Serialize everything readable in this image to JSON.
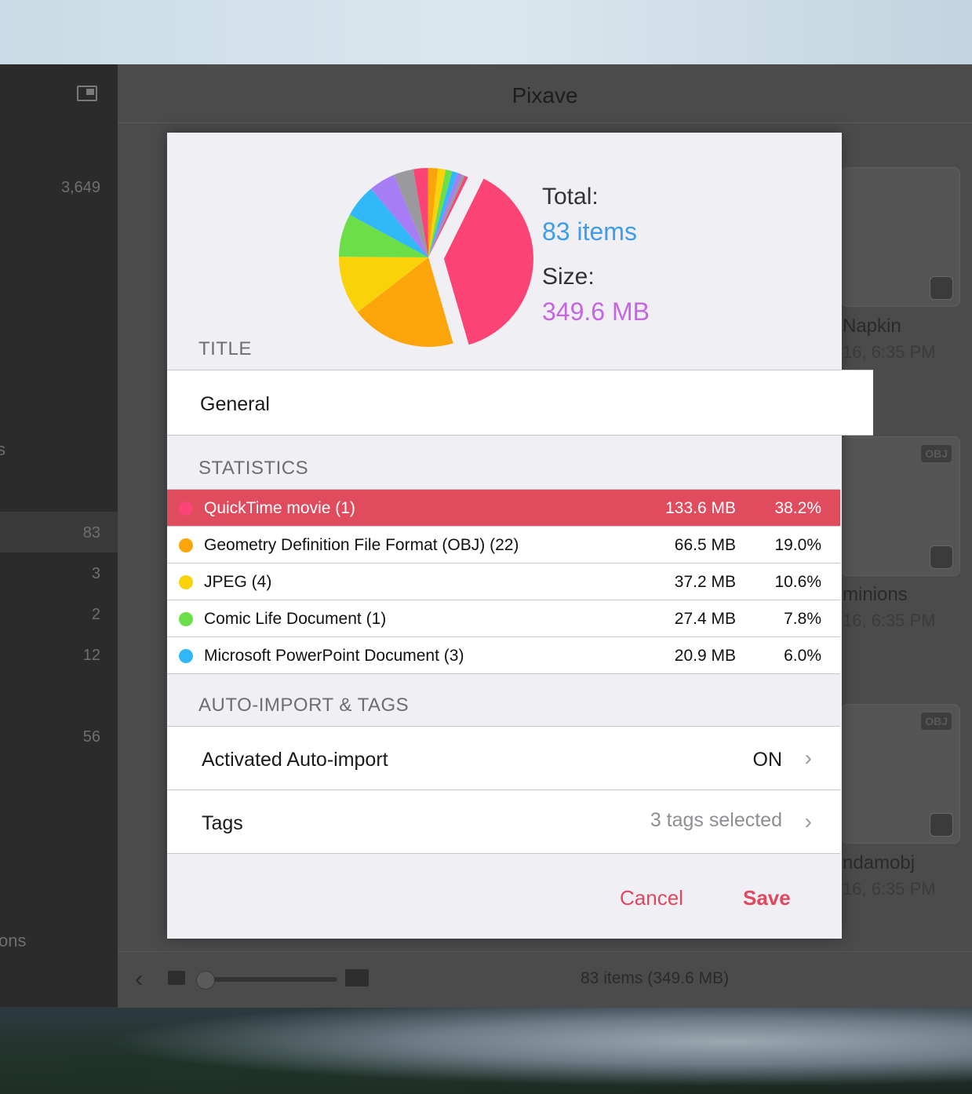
{
  "window": {
    "title": "Pixave"
  },
  "sidebar": {
    "counts": [
      "3,649",
      "83",
      "3",
      "2",
      "12",
      "56"
    ],
    "fragments": [
      "s",
      "ons"
    ]
  },
  "cards": [
    {
      "name": "Napkin",
      "date": "16, 6:35 PM",
      "badge": ""
    },
    {
      "name": "minions",
      "date": "16, 6:35 PM",
      "badge": "OBJ"
    },
    {
      "name": "ndamobj",
      "date": "16, 6:35 PM",
      "badge": "OBJ"
    }
  ],
  "bottom_bar": {
    "status": "83 items (349.6 MB)",
    "back_icon": "chevron-left-icon"
  },
  "dialog": {
    "total_label": "Total:",
    "total_value": "83 items",
    "size_label": "Size:",
    "size_value": "349.6 MB",
    "total_color": "#3d9de8",
    "size_color": "#c466e0",
    "title_header": "TITLE",
    "title_value": "General",
    "stats_header": "STATISTICS",
    "stats": [
      {
        "name": "QuickTime movie (1)",
        "size": "133.6 MB",
        "pct": "38.2%",
        "color": "#fb4475",
        "selected": true
      },
      {
        "name": "Geometry Definition File Format (OBJ) (22)",
        "size": "66.5 MB",
        "pct": "19.0%",
        "color": "#fba50a",
        "selected": false
      },
      {
        "name": "JPEG (4)",
        "size": "37.2 MB",
        "pct": "10.6%",
        "color": "#fad20a",
        "selected": false
      },
      {
        "name": "Comic Life Document (1)",
        "size": "27.4 MB",
        "pct": "7.8%",
        "color": "#6cdf48",
        "selected": false
      },
      {
        "name": "Microsoft PowerPoint Document (3)",
        "size": "20.9 MB",
        "pct": "6.0%",
        "color": "#31b8f8",
        "selected": false
      }
    ],
    "auto_header": "AUTO-IMPORT & TAGS",
    "auto_import_label": "Activated Auto-import",
    "auto_import_value": "ON",
    "tags_label": "Tags",
    "tags_value": "3 tags selected",
    "cancel_label": "Cancel",
    "save_label": "Save"
  },
  "chart_data": {
    "type": "pie",
    "exploded_first_slice": true,
    "slices": [
      {
        "label": "QuickTime movie (1)",
        "value": 38.2,
        "color": "#fb4475"
      },
      {
        "label": "Geometry Definition File Format (OBJ) (22)",
        "value": 19.0,
        "color": "#fba50a"
      },
      {
        "label": "JPEG (4)",
        "value": 10.6,
        "color": "#fad20a"
      },
      {
        "label": "Comic Life Document (1)",
        "value": 7.8,
        "color": "#6cdf48"
      },
      {
        "label": "Microsoft PowerPoint Document (3)",
        "value": 6.0,
        "color": "#31b8f8"
      },
      {
        "label": "",
        "value": 4.8,
        "color": "#a77df5"
      },
      {
        "label": "",
        "value": 3.6,
        "color": "#9a9a9e"
      },
      {
        "label": "",
        "value": 2.6,
        "color": "#fb4475"
      },
      {
        "label": "",
        "value": 1.8,
        "color": "#fba50a"
      },
      {
        "label": "",
        "value": 1.4,
        "color": "#fad20a"
      },
      {
        "label": "",
        "value": 1.2,
        "color": "#6cdf48"
      },
      {
        "label": "",
        "value": 1.0,
        "color": "#31b8f8"
      },
      {
        "label": "",
        "value": 0.8,
        "color": "#a77df5"
      },
      {
        "label": "",
        "value": 0.6,
        "color": "#9a9a9e"
      },
      {
        "label": "",
        "value": 0.6,
        "color": "#fb4475"
      }
    ]
  }
}
